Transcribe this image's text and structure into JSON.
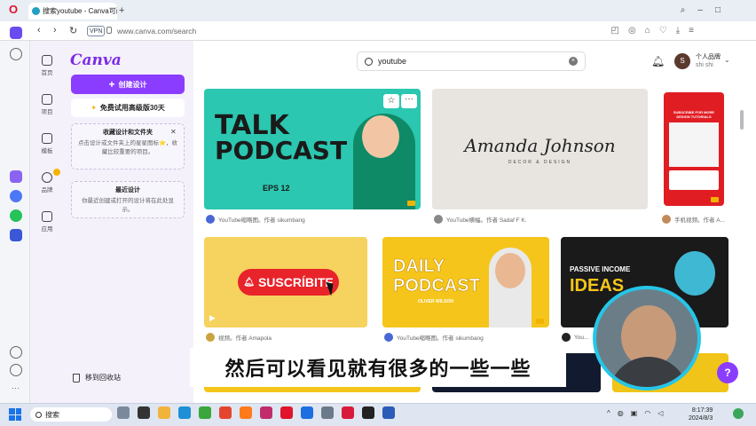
{
  "browser": {
    "tab_title": "搜索youtube - Canva可画",
    "tab_close": "×",
    "new_tab": "+",
    "url": "www.canva.com/search",
    "vpn_label": "VPN",
    "back": "‹",
    "forward": "›",
    "reload": "↻"
  },
  "rail": {
    "items": [
      {
        "label": "首页"
      },
      {
        "label": "项目"
      },
      {
        "label": "模板"
      },
      {
        "label": "品牌"
      },
      {
        "label": "应用"
      }
    ]
  },
  "panel": {
    "logo": "Canva",
    "create_label": "创建设计",
    "create_icon": "+",
    "trial_label": "免费试用高级版30天",
    "starred_title": "收藏设计和文件夹",
    "starred_body": "点击设计或文件夹上的星星图标⭐，收藏比较重要的项目。",
    "starred_close": "✕",
    "recent_title": "最近设计",
    "recent_body": "你最近创建或打开的设计将在此处显示。",
    "trash_label": "移到回收站"
  },
  "header": {
    "search_value": "youtube",
    "clear_icon": "×",
    "avatar_initial": "S",
    "user_name": "个人品牌",
    "user_sub": "shi shi"
  },
  "results": [
    {
      "caption": "YouTube缩略图。作者 sikumbang",
      "title_lines": [
        "TALK",
        "PODCAST"
      ],
      "eps": "EPS 12"
    },
    {
      "caption": "YouTube横幅。作者 Sadaf F K.",
      "script": "Amanda Johnson",
      "tagline": "DECOR & DESIGN"
    },
    {
      "caption": "手机视频。作者 A...",
      "tiny": "SUBSCRIBE FOR MORE DESIGN TUTORIALS"
    },
    {
      "caption": "视频。作者 Amapola",
      "button": "SUSCRÍBITE"
    },
    {
      "caption": "YouTube缩略图。作者 sikumbang",
      "title_lines": [
        "DAILY",
        "PODCAST"
      ],
      "name": "OLIVER WILSON"
    },
    {
      "caption": "You...",
      "title_lines": [
        "PASSIVE INCOME",
        "IDEAS"
      ]
    }
  ],
  "overlay": {
    "subtitle": "然后可以看见就有很多的一些一些",
    "help": "?"
  },
  "taskbar": {
    "search_label": "搜索",
    "time": "8:17:39",
    "date": "2024/8/3"
  },
  "colors": {
    "accent": "#8b3dff",
    "opera_red": "#e0142b",
    "webcam_ring": "#25c6e8"
  }
}
